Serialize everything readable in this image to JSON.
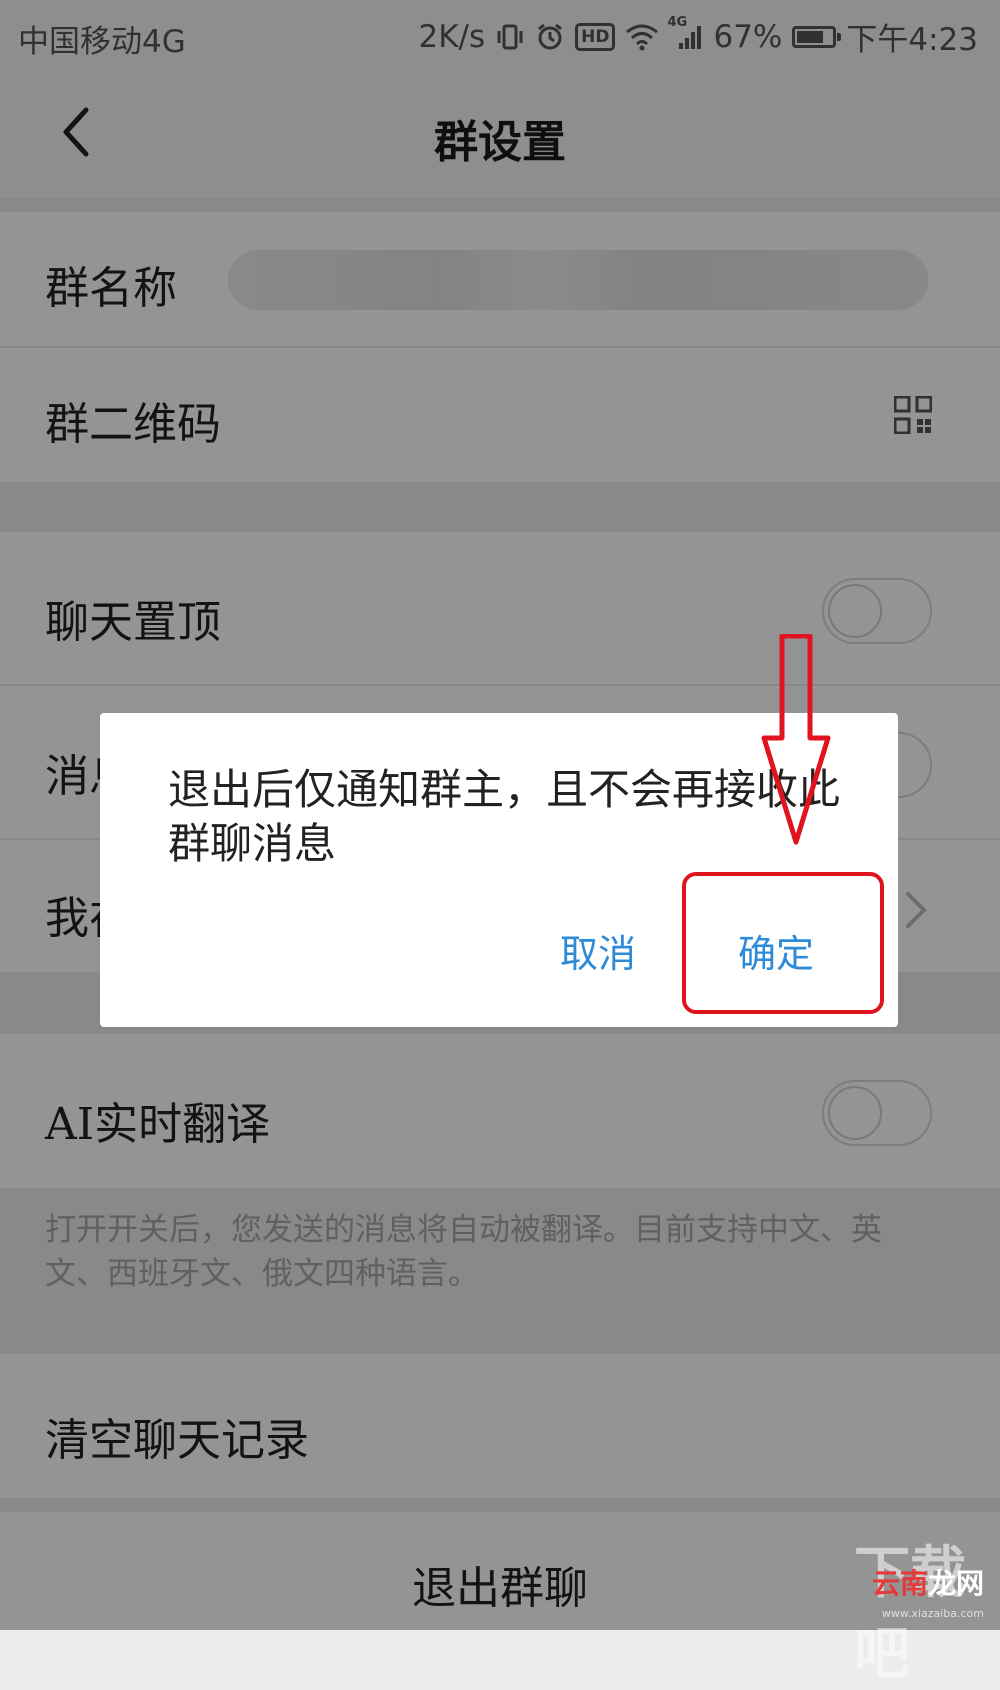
{
  "status_bar": {
    "carrier": "中国移动4G",
    "speed": "2K/s",
    "network": "4G",
    "battery": "67%",
    "time": "下午4:23",
    "hd": "HD",
    "battery_level": 0.67
  },
  "nav": {
    "title": "群设置"
  },
  "settings": {
    "group_name_label": "群名称",
    "group_qr_label": "群二维码",
    "pin_chat_label": "聊天置顶",
    "mute_label": "消息免打扰",
    "my_nickname_label": "我在本群的昵称",
    "ai_translate_label": "AI实时翻译",
    "ai_translate_hint": "打开开关后，您发送的消息将自动被翻译。目前支持中文、英文、西班牙文、俄文四种语言。",
    "clear_history_label": "清空聊天记录",
    "exit_label": "退出群聊"
  },
  "dialog": {
    "message": "退出后仅通知群主，且不会再接收此群聊消息",
    "cancel": "取消",
    "confirm": "确定"
  },
  "watermark": {
    "big": "下载吧",
    "small_a": "云南",
    "small_b": "龙网",
    "url": "www.xiazaiba.com"
  },
  "colors": {
    "accent_blue": "#2f8bd8",
    "annotation_red": "#e0141e"
  }
}
